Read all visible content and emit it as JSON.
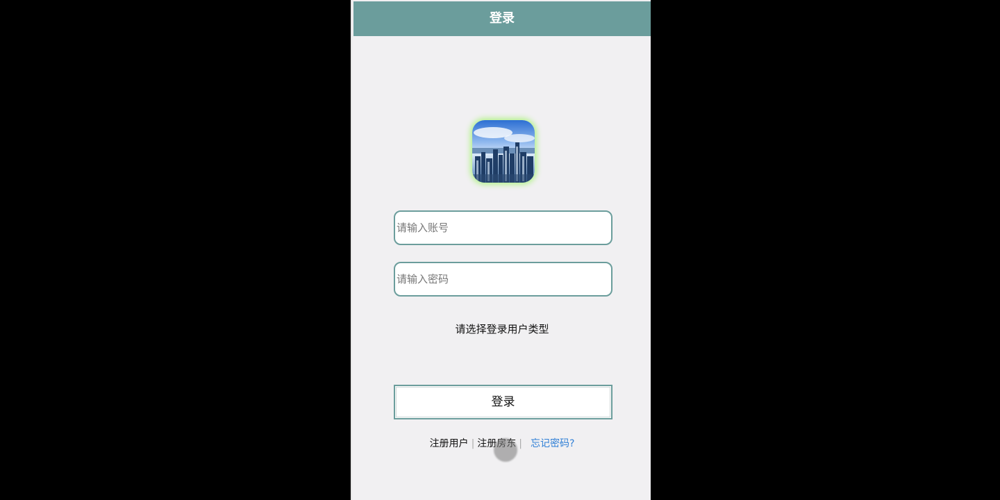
{
  "header": {
    "title": "登录"
  },
  "form": {
    "account_placeholder": "请输入账号",
    "password_placeholder": "请输入密码",
    "user_type_prompt": "请选择登录用户类型",
    "login_label": "登录"
  },
  "links": {
    "register_user": "注册用户",
    "register_landlord": "注册房东",
    "separator": "|",
    "forgot_password": "忘记密码?"
  },
  "colors": {
    "accent": "#6b9d9c",
    "background": "#f1f0f2",
    "link": "#2f7fd6"
  },
  "icons": {
    "logo": "city-skyline-logo"
  }
}
